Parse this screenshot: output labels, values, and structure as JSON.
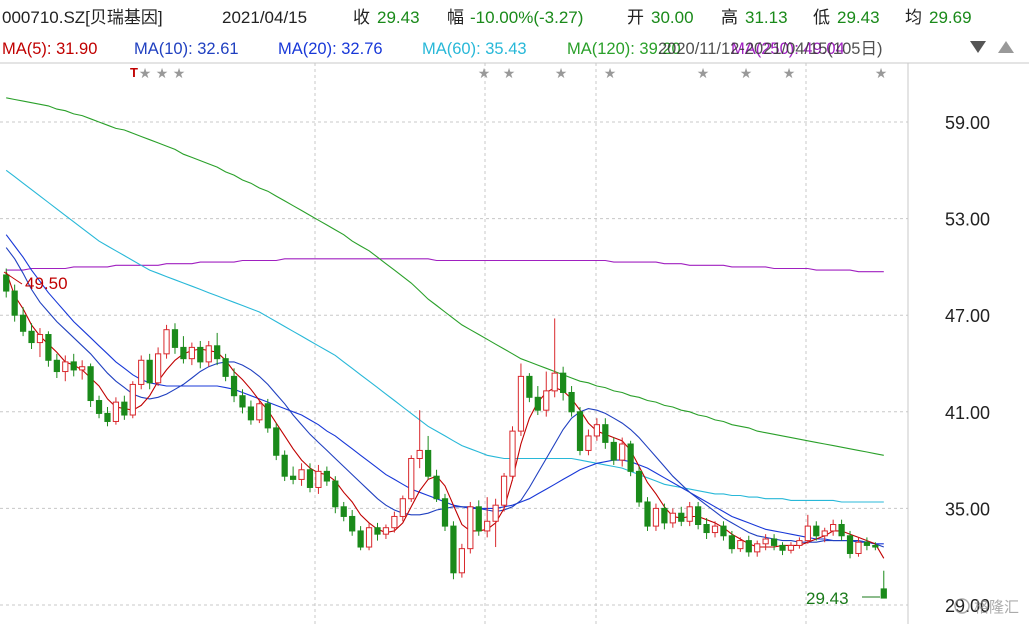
{
  "header": {
    "code": "000710.SZ[贝瑞基因]",
    "date": "2021/04/15",
    "close_label": "收",
    "close": "29.43",
    "chg_label": "幅",
    "chg": "-10.00%(-3.27)",
    "open_label": "开",
    "open": "30.00",
    "high_label": "高",
    "high": "31.13",
    "low_label": "低",
    "low": "29.43",
    "avg_label": "均",
    "avg": "29.69"
  },
  "ma_legend": {
    "ma5": "MA(5): 31.90",
    "ma10": "MA(10): 32.61",
    "ma20": "MA(20): 32.76",
    "ma60": "MA(60): 35.43",
    "ma120": "MA(120): 39.20",
    "ma250": "MA(250): 49.04",
    "range": "2020/11/12-2021/04/15(105日)"
  },
  "annotations": {
    "high_marker": "49.50",
    "low_marker": "29.43"
  },
  "watermark": "格隆汇",
  "colors": {
    "up": "#d9282d",
    "down": "#1a8a1a",
    "ma5": "#c00000",
    "ma10": "#2040c0",
    "ma20": "#1838d8",
    "ma60": "#28b8d8",
    "ma120": "#2aa02a",
    "ma250": "#a020c0",
    "grid": "#c8c8c8",
    "axis_text": "#222222",
    "price_tag": "#1a7a1a"
  },
  "chart_data": {
    "type": "candlestick",
    "ylim": [
      29.0,
      61.0
    ],
    "yticks": [
      "59.00",
      "53.00",
      "47.00",
      "41.00",
      "35.00",
      "29.00"
    ],
    "candles": [
      [
        49.5,
        49.9,
        48.1,
        48.5
      ],
      [
        48.5,
        48.9,
        46.6,
        47.0
      ],
      [
        47.0,
        47.5,
        45.7,
        46.0
      ],
      [
        46.0,
        46.5,
        44.9,
        45.3
      ],
      [
        45.3,
        46.2,
        44.4,
        45.8
      ],
      [
        45.8,
        46.0,
        43.8,
        44.2
      ],
      [
        44.2,
        44.6,
        43.1,
        43.5
      ],
      [
        43.5,
        44.5,
        42.9,
        44.1
      ],
      [
        44.1,
        44.6,
        43.2,
        43.6
      ],
      [
        43.6,
        44.2,
        43.0,
        43.8
      ],
      [
        43.8,
        44.0,
        41.3,
        41.7
      ],
      [
        41.7,
        42.0,
        40.6,
        40.9
      ],
      [
        40.9,
        41.3,
        40.1,
        40.4
      ],
      [
        40.4,
        41.9,
        40.2,
        41.6
      ],
      [
        41.6,
        42.0,
        40.5,
        40.8
      ],
      [
        40.8,
        42.9,
        40.6,
        42.7
      ],
      [
        42.7,
        44.5,
        42.4,
        44.2
      ],
      [
        44.2,
        44.6,
        42.4,
        42.8
      ],
      [
        42.8,
        45.0,
        42.6,
        44.6
      ],
      [
        44.6,
        46.4,
        44.3,
        46.1
      ],
      [
        46.1,
        46.5,
        44.6,
        45.0
      ],
      [
        45.0,
        45.7,
        44.0,
        44.3
      ],
      [
        44.3,
        45.3,
        43.9,
        45.0
      ],
      [
        45.0,
        45.4,
        43.7,
        44.1
      ],
      [
        44.1,
        45.4,
        43.8,
        45.1
      ],
      [
        45.1,
        45.9,
        43.9,
        44.3
      ],
      [
        44.3,
        44.6,
        42.9,
        43.2
      ],
      [
        43.2,
        43.7,
        41.6,
        42.0
      ],
      [
        42.0,
        42.4,
        40.9,
        41.3
      ],
      [
        41.3,
        41.7,
        40.2,
        40.5
      ],
      [
        40.5,
        41.8,
        40.3,
        41.5
      ],
      [
        41.5,
        41.8,
        39.7,
        40.0
      ],
      [
        40.0,
        40.3,
        38.0,
        38.3
      ],
      [
        38.3,
        38.6,
        36.7,
        37.0
      ],
      [
        37.0,
        37.6,
        36.5,
        36.8
      ],
      [
        36.8,
        37.8,
        36.4,
        37.4
      ],
      [
        37.4,
        37.8,
        36.0,
        36.3
      ],
      [
        36.3,
        37.7,
        35.9,
        37.3
      ],
      [
        37.3,
        37.6,
        36.4,
        36.7
      ],
      [
        36.7,
        37.0,
        34.7,
        35.1
      ],
      [
        35.1,
        35.4,
        34.2,
        34.5
      ],
      [
        34.5,
        34.9,
        33.3,
        33.6
      ],
      [
        33.6,
        33.9,
        32.4,
        32.6
      ],
      [
        32.6,
        34.1,
        32.4,
        33.8
      ],
      [
        33.8,
        34.1,
        33.0,
        33.4
      ],
      [
        33.4,
        34.0,
        33.1,
        33.8
      ],
      [
        33.8,
        34.8,
        33.5,
        34.5
      ],
      [
        34.5,
        35.8,
        34.2,
        35.6
      ],
      [
        35.6,
        38.3,
        35.4,
        38.1
      ],
      [
        38.1,
        41.1,
        37.5,
        38.6
      ],
      [
        38.6,
        39.5,
        36.8,
        37.0
      ],
      [
        37.0,
        37.4,
        35.4,
        35.6
      ],
      [
        35.6,
        35.9,
        33.6,
        33.9
      ],
      [
        33.9,
        34.2,
        30.6,
        31.0
      ],
      [
        31.0,
        32.8,
        30.7,
        32.5
      ],
      [
        32.5,
        35.4,
        32.2,
        35.1
      ],
      [
        35.1,
        35.5,
        33.3,
        33.6
      ],
      [
        33.6,
        35.7,
        33.2,
        34.2
      ],
      [
        34.2,
        35.6,
        32.6,
        35.2
      ],
      [
        35.2,
        37.2,
        34.8,
        37.0
      ],
      [
        37.0,
        40.1,
        36.7,
        39.8
      ],
      [
        39.8,
        44.0,
        39.5,
        43.2
      ],
      [
        43.2,
        43.4,
        41.6,
        41.9
      ],
      [
        41.9,
        42.6,
        40.8,
        41.1
      ],
      [
        41.1,
        43.5,
        40.7,
        42.3
      ],
      [
        42.3,
        46.8,
        41.9,
        43.4
      ],
      [
        43.4,
        43.8,
        41.7,
        42.2
      ],
      [
        42.2,
        42.6,
        40.7,
        41.0
      ],
      [
        41.0,
        41.3,
        38.3,
        38.6
      ],
      [
        38.6,
        39.9,
        38.3,
        39.5
      ],
      [
        39.5,
        40.6,
        39.2,
        40.2
      ],
      [
        40.2,
        40.6,
        38.7,
        39.1
      ],
      [
        39.1,
        39.4,
        37.7,
        38.0
      ],
      [
        38.0,
        39.4,
        37.6,
        39.0
      ],
      [
        39.0,
        39.2,
        37.0,
        37.3
      ],
      [
        37.3,
        37.6,
        35.1,
        35.4
      ],
      [
        35.4,
        35.7,
        33.6,
        33.9
      ],
      [
        33.9,
        35.3,
        33.6,
        35.0
      ],
      [
        35.0,
        35.3,
        33.7,
        34.1
      ],
      [
        34.1,
        35.0,
        33.8,
        34.7
      ],
      [
        34.7,
        35.1,
        33.9,
        34.2
      ],
      [
        34.2,
        35.4,
        33.9,
        35.1
      ],
      [
        35.1,
        35.4,
        33.7,
        34.0
      ],
      [
        34.0,
        34.4,
        33.1,
        33.5
      ],
      [
        33.5,
        34.2,
        33.2,
        33.9
      ],
      [
        33.9,
        34.2,
        33.0,
        33.3
      ],
      [
        33.3,
        33.6,
        32.2,
        32.5
      ],
      [
        32.5,
        33.2,
        32.3,
        33.0
      ],
      [
        33.0,
        33.3,
        32.0,
        32.3
      ],
      [
        32.3,
        33.0,
        32.0,
        32.8
      ],
      [
        32.8,
        33.4,
        32.4,
        33.1
      ],
      [
        33.1,
        33.4,
        32.4,
        32.7
      ],
      [
        32.7,
        32.9,
        32.1,
        32.4
      ],
      [
        32.4,
        32.9,
        32.2,
        32.7
      ],
      [
        32.7,
        33.2,
        32.5,
        33.0
      ],
      [
        33.0,
        34.6,
        32.8,
        33.9
      ],
      [
        33.9,
        34.2,
        33.0,
        33.3
      ],
      [
        33.3,
        33.8,
        32.9,
        33.6
      ],
      [
        33.6,
        34.3,
        33.3,
        34.0
      ],
      [
        34.0,
        34.3,
        33.0,
        33.3
      ],
      [
        33.3,
        33.6,
        31.9,
        32.2
      ],
      [
        32.2,
        33.2,
        32.0,
        32.9
      ],
      [
        32.9,
        33.2,
        32.4,
        32.7
      ],
      [
        32.7,
        32.9,
        32.4,
        32.6
      ],
      [
        30.0,
        31.13,
        29.43,
        29.43
      ]
    ],
    "ma_lines": {
      "ma5": [
        49.7,
        48.2,
        47.4,
        46.4,
        45.7,
        45.2,
        44.7,
        44.1,
        43.9,
        43.6,
        43.1,
        42.6,
        41.8,
        41.3,
        41.2,
        41.1,
        41.4,
        42.0,
        42.9,
        43.6,
        44.2,
        44.6,
        44.8,
        44.9,
        44.8,
        44.7,
        44.2,
        43.5,
        43.0,
        42.4,
        41.7,
        41.1,
        40.3,
        39.5,
        38.7,
        38.0,
        37.5,
        37.2,
        37.1,
        36.7,
        36.0,
        35.4,
        34.6,
        34.1,
        33.7,
        33.5,
        33.6,
        34.1,
        35.1,
        36.1,
        36.8,
        37.0,
        36.4,
        35.2,
        34.0,
        33.6,
        33.6,
        33.7,
        34.1,
        35.0,
        36.8,
        39.0,
        40.6,
        41.6,
        42.2,
        42.5,
        42.3,
        41.8,
        41.1,
        40.3,
        39.8,
        39.6,
        39.4,
        39.2,
        38.6,
        37.6,
        36.6,
        35.9,
        35.1,
        34.5,
        34.4,
        34.5,
        34.5,
        34.3,
        34.1,
        33.8,
        33.4,
        33.1,
        32.8,
        32.6,
        32.6,
        32.6,
        32.7,
        32.7,
        32.7,
        32.9,
        33.1,
        33.3,
        33.6,
        33.6,
        33.4,
        33.2,
        33.0,
        32.8,
        31.9
      ],
      "ma10": [
        51.2,
        50.5,
        49.6,
        48.6,
        47.8,
        47.2,
        46.6,
        46.1,
        45.6,
        45.1,
        44.6,
        44.0,
        43.4,
        42.9,
        42.5,
        42.1,
        41.9,
        41.8,
        41.9,
        42.1,
        42.4,
        42.7,
        43.1,
        43.5,
        43.8,
        44.0,
        44.1,
        44.1,
        43.9,
        43.6,
        43.2,
        42.7,
        42.1,
        41.5,
        40.8,
        40.2,
        39.6,
        39.1,
        38.6,
        38.1,
        37.6,
        37.1,
        36.6,
        36.1,
        35.6,
        35.2,
        34.9,
        34.7,
        34.6,
        34.6,
        34.7,
        34.9,
        35.0,
        35.1,
        35.1,
        35.1,
        35.0,
        34.9,
        34.8,
        34.9,
        35.1,
        35.5,
        36.3,
        37.2,
        38.1,
        39.0,
        39.9,
        40.6,
        41.0,
        41.2,
        41.1,
        40.9,
        40.6,
        40.3,
        39.9,
        39.4,
        38.8,
        38.2,
        37.6,
        37.0,
        36.5,
        36.0,
        35.6,
        35.2,
        34.8,
        34.4,
        34.1,
        33.8,
        33.5,
        33.3,
        33.2,
        33.1,
        33.0,
        33.0,
        32.9,
        32.9,
        32.9,
        33.0,
        33.0,
        33.0,
        33.0,
        33.0,
        32.9,
        32.8,
        32.6
      ],
      "ma20": [
        52.0,
        51.3,
        50.6,
        49.8,
        49.1,
        48.4,
        47.8,
        47.2,
        46.6,
        46.1,
        45.6,
        45.1,
        44.6,
        44.1,
        43.7,
        43.3,
        43.0,
        42.8,
        42.7,
        42.6,
        42.6,
        42.6,
        42.6,
        42.6,
        42.6,
        42.6,
        42.5,
        42.4,
        42.2,
        42.0,
        41.8,
        41.6,
        41.4,
        41.2,
        41.0,
        40.8,
        40.5,
        40.2,
        39.8,
        39.5,
        39.1,
        38.7,
        38.3,
        37.9,
        37.5,
        37.1,
        36.8,
        36.5,
        36.2,
        36.0,
        35.8,
        35.6,
        35.4,
        35.2,
        35.1,
        35.0,
        35.0,
        35.0,
        35.0,
        35.1,
        35.2,
        35.4,
        35.6,
        35.9,
        36.2,
        36.5,
        36.8,
        37.1,
        37.4,
        37.6,
        37.8,
        37.9,
        38.0,
        38.0,
        37.9,
        37.7,
        37.5,
        37.2,
        36.9,
        36.6,
        36.3,
        36.0,
        35.7,
        35.4,
        35.1,
        34.8,
        34.5,
        34.3,
        34.1,
        33.9,
        33.7,
        33.6,
        33.5,
        33.4,
        33.3,
        33.2,
        33.1,
        33.1,
        33.0,
        33.0,
        33.0,
        32.9,
        32.9,
        32.8,
        32.8
      ],
      "ma60": [
        56.0,
        55.6,
        55.2,
        54.8,
        54.4,
        54.0,
        53.6,
        53.2,
        52.8,
        52.4,
        52.0,
        51.6,
        51.3,
        51.0,
        50.7,
        50.4,
        50.1,
        49.8,
        49.6,
        49.4,
        49.2,
        49.0,
        48.8,
        48.6,
        48.4,
        48.2,
        48.0,
        47.8,
        47.6,
        47.4,
        47.2,
        46.9,
        46.6,
        46.3,
        46.0,
        45.7,
        45.4,
        45.1,
        44.8,
        44.5,
        44.1,
        43.7,
        43.3,
        42.9,
        42.5,
        42.1,
        41.7,
        41.3,
        40.9,
        40.5,
        40.1,
        39.8,
        39.5,
        39.2,
        38.9,
        38.7,
        38.5,
        38.3,
        38.2,
        38.1,
        38.1,
        38.1,
        38.1,
        38.1,
        38.1,
        38.1,
        38.1,
        38.1,
        38.0,
        37.9,
        37.8,
        37.7,
        37.6,
        37.5,
        37.3,
        37.1,
        36.9,
        36.7,
        36.5,
        36.4,
        36.3,
        36.2,
        36.1,
        36.0,
        35.9,
        35.9,
        35.8,
        35.8,
        35.7,
        35.7,
        35.6,
        35.6,
        35.6,
        35.5,
        35.5,
        35.5,
        35.5,
        35.5,
        35.5,
        35.4,
        35.4,
        35.4,
        35.4,
        35.4,
        35.4
      ],
      "ma120": [
        60.5,
        60.4,
        60.3,
        60.2,
        60.1,
        60.0,
        59.8,
        59.7,
        59.5,
        59.4,
        59.2,
        59.0,
        58.8,
        58.6,
        58.5,
        58.3,
        58.1,
        57.9,
        57.7,
        57.5,
        57.3,
        57.0,
        56.8,
        56.6,
        56.4,
        56.2,
        55.9,
        55.7,
        55.4,
        55.2,
        54.9,
        54.7,
        54.4,
        54.1,
        53.8,
        53.5,
        53.2,
        52.9,
        52.6,
        52.3,
        52.0,
        51.6,
        51.3,
        51.0,
        50.6,
        50.2,
        49.8,
        49.4,
        49.0,
        48.5,
        48.0,
        47.6,
        47.2,
        46.8,
        46.4,
        46.1,
        45.8,
        45.5,
        45.2,
        44.9,
        44.6,
        44.3,
        44.1,
        43.9,
        43.7,
        43.5,
        43.3,
        43.1,
        42.9,
        42.8,
        42.6,
        42.5,
        42.3,
        42.2,
        42.0,
        41.9,
        41.7,
        41.6,
        41.4,
        41.3,
        41.1,
        41.0,
        40.8,
        40.7,
        40.5,
        40.4,
        40.2,
        40.1,
        40.0,
        39.8,
        39.7,
        39.6,
        39.5,
        39.4,
        39.3,
        39.2,
        39.1,
        39.0,
        38.9,
        38.8,
        38.7,
        38.6,
        38.5,
        38.4,
        38.3
      ],
      "ma250": [
        49.8,
        49.8,
        49.8,
        49.9,
        49.9,
        49.9,
        49.9,
        49.9,
        50.0,
        50.0,
        50.0,
        50.0,
        50.0,
        50.1,
        50.1,
        50.1,
        50.1,
        50.1,
        50.1,
        50.2,
        50.2,
        50.2,
        50.2,
        50.3,
        50.3,
        50.3,
        50.3,
        50.3,
        50.4,
        50.4,
        50.4,
        50.4,
        50.4,
        50.5,
        50.5,
        50.5,
        50.5,
        50.5,
        50.5,
        50.5,
        50.5,
        50.5,
        50.5,
        50.5,
        50.5,
        50.5,
        50.5,
        50.5,
        50.5,
        50.5,
        50.5,
        50.4,
        50.4,
        50.4,
        50.4,
        50.4,
        50.4,
        50.4,
        50.4,
        50.4,
        50.4,
        50.4,
        50.4,
        50.4,
        50.4,
        50.4,
        50.4,
        50.4,
        50.4,
        50.4,
        50.4,
        50.4,
        50.3,
        50.3,
        50.3,
        50.3,
        50.3,
        50.3,
        50.2,
        50.2,
        50.2,
        50.1,
        50.1,
        50.1,
        50.1,
        50.1,
        50.0,
        50.0,
        50.0,
        50.0,
        50.0,
        49.9,
        49.9,
        49.9,
        49.9,
        49.9,
        49.8,
        49.8,
        49.8,
        49.8,
        49.8,
        49.7,
        49.7,
        49.7,
        49.7
      ]
    }
  }
}
